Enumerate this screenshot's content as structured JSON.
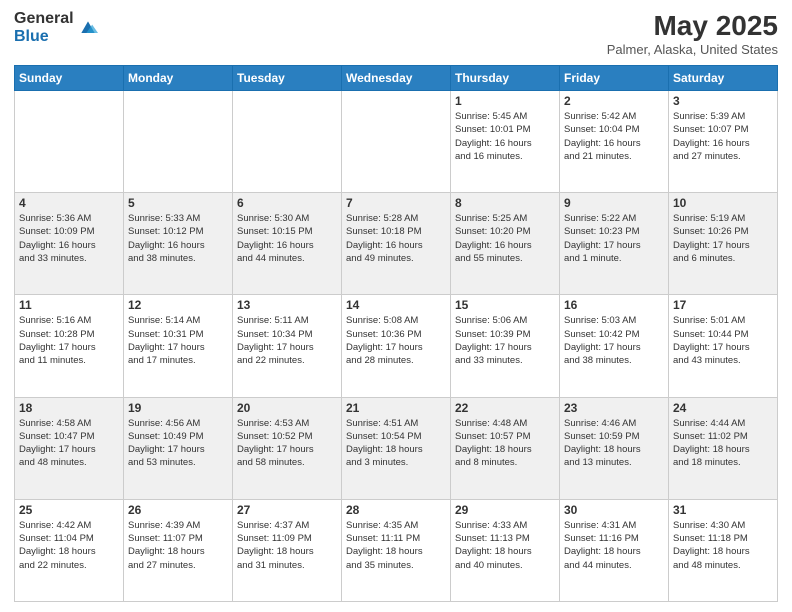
{
  "logo": {
    "general": "General",
    "blue": "Blue"
  },
  "header": {
    "title": "May 2025",
    "subtitle": "Palmer, Alaska, United States"
  },
  "weekdays": [
    "Sunday",
    "Monday",
    "Tuesday",
    "Wednesday",
    "Thursday",
    "Friday",
    "Saturday"
  ],
  "weeks": [
    [
      {
        "day": "",
        "info": ""
      },
      {
        "day": "",
        "info": ""
      },
      {
        "day": "",
        "info": ""
      },
      {
        "day": "",
        "info": ""
      },
      {
        "day": "1",
        "info": "Sunrise: 5:45 AM\nSunset: 10:01 PM\nDaylight: 16 hours\nand 16 minutes."
      },
      {
        "day": "2",
        "info": "Sunrise: 5:42 AM\nSunset: 10:04 PM\nDaylight: 16 hours\nand 21 minutes."
      },
      {
        "day": "3",
        "info": "Sunrise: 5:39 AM\nSunset: 10:07 PM\nDaylight: 16 hours\nand 27 minutes."
      }
    ],
    [
      {
        "day": "4",
        "info": "Sunrise: 5:36 AM\nSunset: 10:09 PM\nDaylight: 16 hours\nand 33 minutes."
      },
      {
        "day": "5",
        "info": "Sunrise: 5:33 AM\nSunset: 10:12 PM\nDaylight: 16 hours\nand 38 minutes."
      },
      {
        "day": "6",
        "info": "Sunrise: 5:30 AM\nSunset: 10:15 PM\nDaylight: 16 hours\nand 44 minutes."
      },
      {
        "day": "7",
        "info": "Sunrise: 5:28 AM\nSunset: 10:18 PM\nDaylight: 16 hours\nand 49 minutes."
      },
      {
        "day": "8",
        "info": "Sunrise: 5:25 AM\nSunset: 10:20 PM\nDaylight: 16 hours\nand 55 minutes."
      },
      {
        "day": "9",
        "info": "Sunrise: 5:22 AM\nSunset: 10:23 PM\nDaylight: 17 hours\nand 1 minute."
      },
      {
        "day": "10",
        "info": "Sunrise: 5:19 AM\nSunset: 10:26 PM\nDaylight: 17 hours\nand 6 minutes."
      }
    ],
    [
      {
        "day": "11",
        "info": "Sunrise: 5:16 AM\nSunset: 10:28 PM\nDaylight: 17 hours\nand 11 minutes."
      },
      {
        "day": "12",
        "info": "Sunrise: 5:14 AM\nSunset: 10:31 PM\nDaylight: 17 hours\nand 17 minutes."
      },
      {
        "day": "13",
        "info": "Sunrise: 5:11 AM\nSunset: 10:34 PM\nDaylight: 17 hours\nand 22 minutes."
      },
      {
        "day": "14",
        "info": "Sunrise: 5:08 AM\nSunset: 10:36 PM\nDaylight: 17 hours\nand 28 minutes."
      },
      {
        "day": "15",
        "info": "Sunrise: 5:06 AM\nSunset: 10:39 PM\nDaylight: 17 hours\nand 33 minutes."
      },
      {
        "day": "16",
        "info": "Sunrise: 5:03 AM\nSunset: 10:42 PM\nDaylight: 17 hours\nand 38 minutes."
      },
      {
        "day": "17",
        "info": "Sunrise: 5:01 AM\nSunset: 10:44 PM\nDaylight: 17 hours\nand 43 minutes."
      }
    ],
    [
      {
        "day": "18",
        "info": "Sunrise: 4:58 AM\nSunset: 10:47 PM\nDaylight: 17 hours\nand 48 minutes."
      },
      {
        "day": "19",
        "info": "Sunrise: 4:56 AM\nSunset: 10:49 PM\nDaylight: 17 hours\nand 53 minutes."
      },
      {
        "day": "20",
        "info": "Sunrise: 4:53 AM\nSunset: 10:52 PM\nDaylight: 17 hours\nand 58 minutes."
      },
      {
        "day": "21",
        "info": "Sunrise: 4:51 AM\nSunset: 10:54 PM\nDaylight: 18 hours\nand 3 minutes."
      },
      {
        "day": "22",
        "info": "Sunrise: 4:48 AM\nSunset: 10:57 PM\nDaylight: 18 hours\nand 8 minutes."
      },
      {
        "day": "23",
        "info": "Sunrise: 4:46 AM\nSunset: 10:59 PM\nDaylight: 18 hours\nand 13 minutes."
      },
      {
        "day": "24",
        "info": "Sunrise: 4:44 AM\nSunset: 11:02 PM\nDaylight: 18 hours\nand 18 minutes."
      }
    ],
    [
      {
        "day": "25",
        "info": "Sunrise: 4:42 AM\nSunset: 11:04 PM\nDaylight: 18 hours\nand 22 minutes."
      },
      {
        "day": "26",
        "info": "Sunrise: 4:39 AM\nSunset: 11:07 PM\nDaylight: 18 hours\nand 27 minutes."
      },
      {
        "day": "27",
        "info": "Sunrise: 4:37 AM\nSunset: 11:09 PM\nDaylight: 18 hours\nand 31 minutes."
      },
      {
        "day": "28",
        "info": "Sunrise: 4:35 AM\nSunset: 11:11 PM\nDaylight: 18 hours\nand 35 minutes."
      },
      {
        "day": "29",
        "info": "Sunrise: 4:33 AM\nSunset: 11:13 PM\nDaylight: 18 hours\nand 40 minutes."
      },
      {
        "day": "30",
        "info": "Sunrise: 4:31 AM\nSunset: 11:16 PM\nDaylight: 18 hours\nand 44 minutes."
      },
      {
        "day": "31",
        "info": "Sunrise: 4:30 AM\nSunset: 11:18 PM\nDaylight: 18 hours\nand 48 minutes."
      }
    ]
  ]
}
